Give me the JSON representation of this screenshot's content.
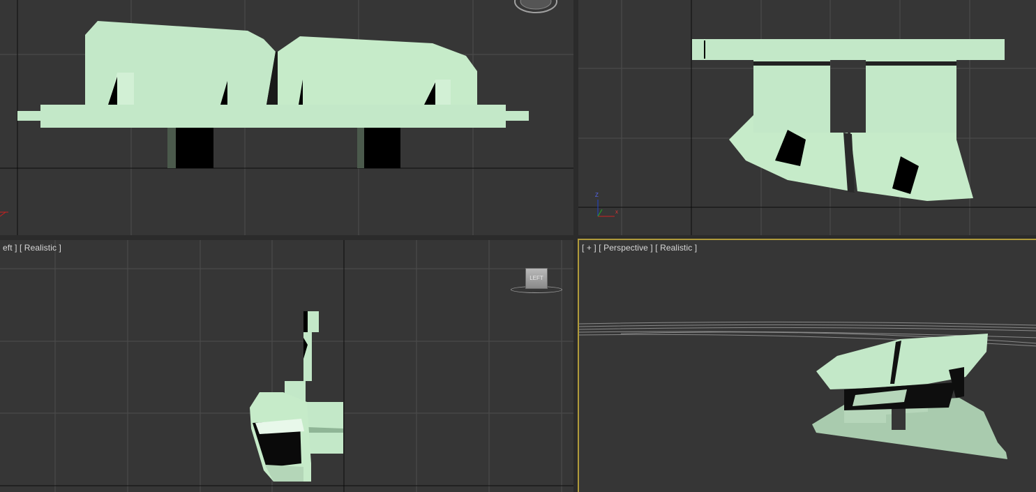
{
  "viewports": {
    "front": {
      "label": ""
    },
    "left_top": {
      "label": ""
    },
    "left": {
      "label": "eft ] [ Realistic ]",
      "viewcube_text": "LEFT"
    },
    "perspective": {
      "label": "[ + ] [ Perspective ] [ Realistic ]"
    }
  },
  "axis_gizmo": {
    "z_label": "Z",
    "x_label": "x",
    "y_label": "y"
  },
  "colors": {
    "viewport_bg": "#363636",
    "grid": "#4e4e4e",
    "grid_axis": "#0a0a0a",
    "model": "#c3e8c8",
    "model_shade": "#9fc7a6",
    "active_border": "#b09a3a"
  }
}
